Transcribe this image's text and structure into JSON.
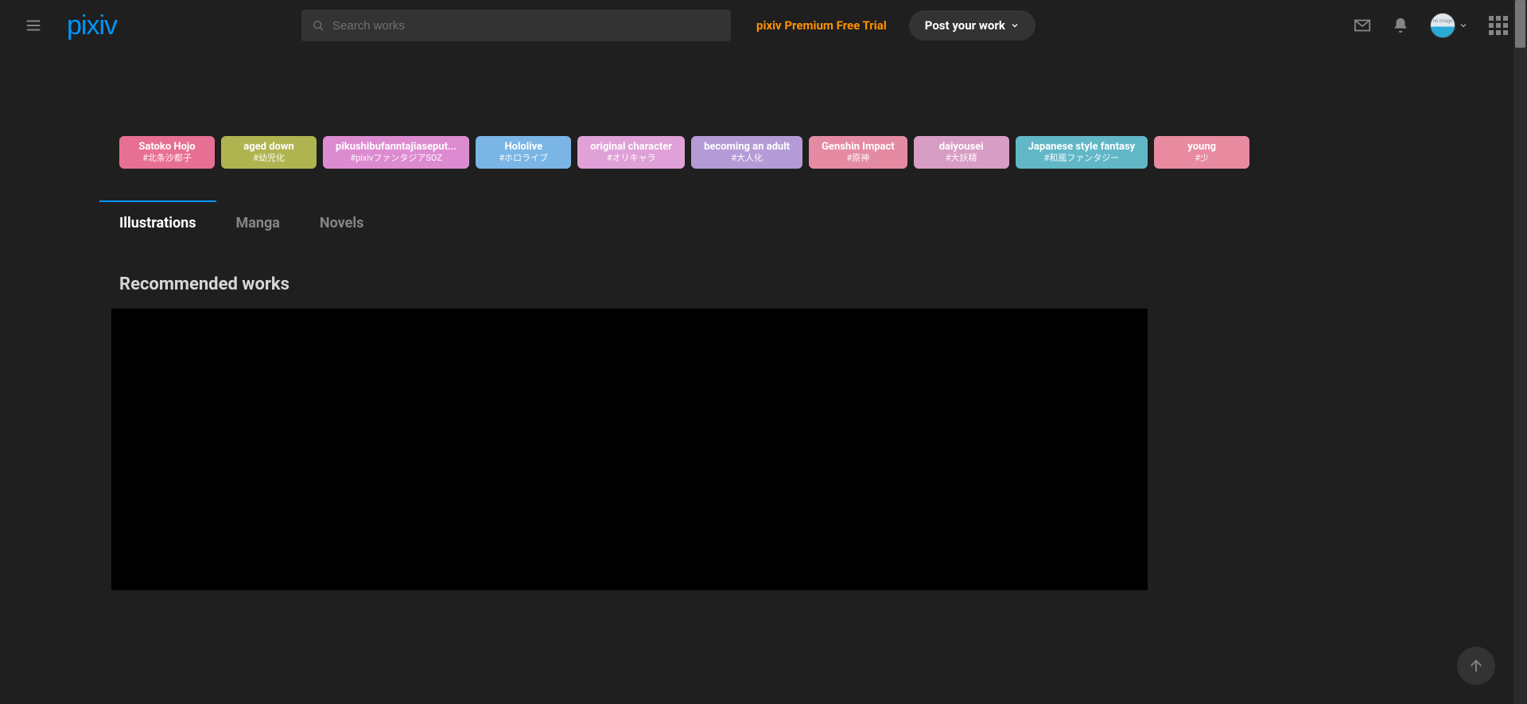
{
  "header": {
    "search_placeholder": "Search works",
    "premium_label": "pixiv Premium Free Trial",
    "post_label": "Post your work",
    "logo_text": "pixiv"
  },
  "chips": [
    {
      "main": "Satoko Hojo",
      "sub": "#北条沙都子",
      "bg": "#e76f93"
    },
    {
      "main": "aged down",
      "sub": "#幼児化",
      "bg": "#b0b450"
    },
    {
      "main": "pikushibufanntajiaseput...",
      "sub": "#pixivファンタジアSOZ",
      "bg": "#dd8bd0"
    },
    {
      "main": "Hololive",
      "sub": "#ホロライブ",
      "bg": "#7ab5e6"
    },
    {
      "main": "original character",
      "sub": "#オリキャラ",
      "bg": "#dfa1d7"
    },
    {
      "main": "becoming an adult",
      "sub": "#大人化",
      "bg": "#b59bd6"
    },
    {
      "main": "Genshin Impact",
      "sub": "#原神",
      "bg": "#e58aa3"
    },
    {
      "main": "daiyousei",
      "sub": "#大妖精",
      "bg": "#d79dc4"
    },
    {
      "main": "Japanese style fantasy",
      "sub": "#和風ファンタジー",
      "bg": "#62b7c7"
    },
    {
      "main": "young",
      "sub": "#少",
      "bg": "#e88aa0"
    }
  ],
  "tabs": [
    {
      "label": "Illustrations",
      "active": true
    },
    {
      "label": "Manga",
      "active": false
    },
    {
      "label": "Novels",
      "active": false
    }
  ],
  "section_title": "Recommended works"
}
